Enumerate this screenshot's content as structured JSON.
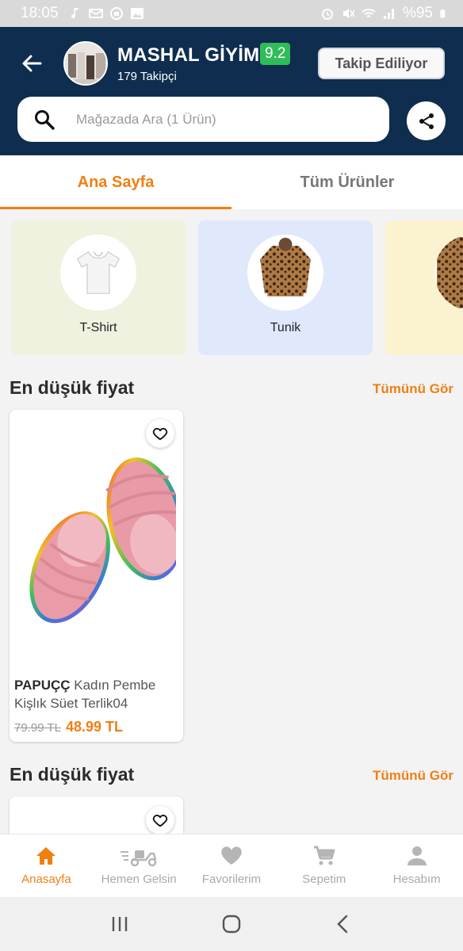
{
  "statusbar": {
    "time": "18:05",
    "battery": "%95"
  },
  "store": {
    "name": "MASHAL GİYİM",
    "rating": "9.2",
    "followers": "179 Takipçi",
    "follow_label": "Takip Ediliyor"
  },
  "search": {
    "placeholder": "Mağazada Ara (1 Ürün)"
  },
  "tabs": [
    {
      "label": "Ana Sayfa",
      "active": true
    },
    {
      "label": "Tüm Ürünler",
      "active": false
    }
  ],
  "categories": [
    {
      "label": "T-Shirt",
      "bg": "#eef2df"
    },
    {
      "label": "Tunik",
      "bg": "#e0e8fc"
    },
    {
      "label": "",
      "bg": "#fbf2cf"
    }
  ],
  "sections": [
    {
      "title": "En düşük fiyat",
      "see_all": "Tümünü Gör",
      "product": {
        "brand": "PAPUÇÇ",
        "name": "Kadın Pembe Kişlık Süet Terlik04",
        "old_price": "79.99 TL",
        "price": "48.99 TL"
      }
    },
    {
      "title": "En düşük fiyat",
      "see_all": "Tümünü Gör"
    }
  ],
  "bottom_nav": [
    {
      "label": "Anasayfa",
      "icon": "home-icon",
      "active": true
    },
    {
      "label": "Hemen Gelsin",
      "icon": "scooter-icon",
      "active": false
    },
    {
      "label": "Favorilerim",
      "icon": "heart-icon",
      "active": false
    },
    {
      "label": "Sepetim",
      "icon": "cart-icon",
      "active": false
    },
    {
      "label": "Hesabım",
      "icon": "person-icon",
      "active": false
    }
  ],
  "colors": {
    "header": "#0f2d4e",
    "accent": "#f07f13",
    "rating": "#2fbd5a"
  }
}
